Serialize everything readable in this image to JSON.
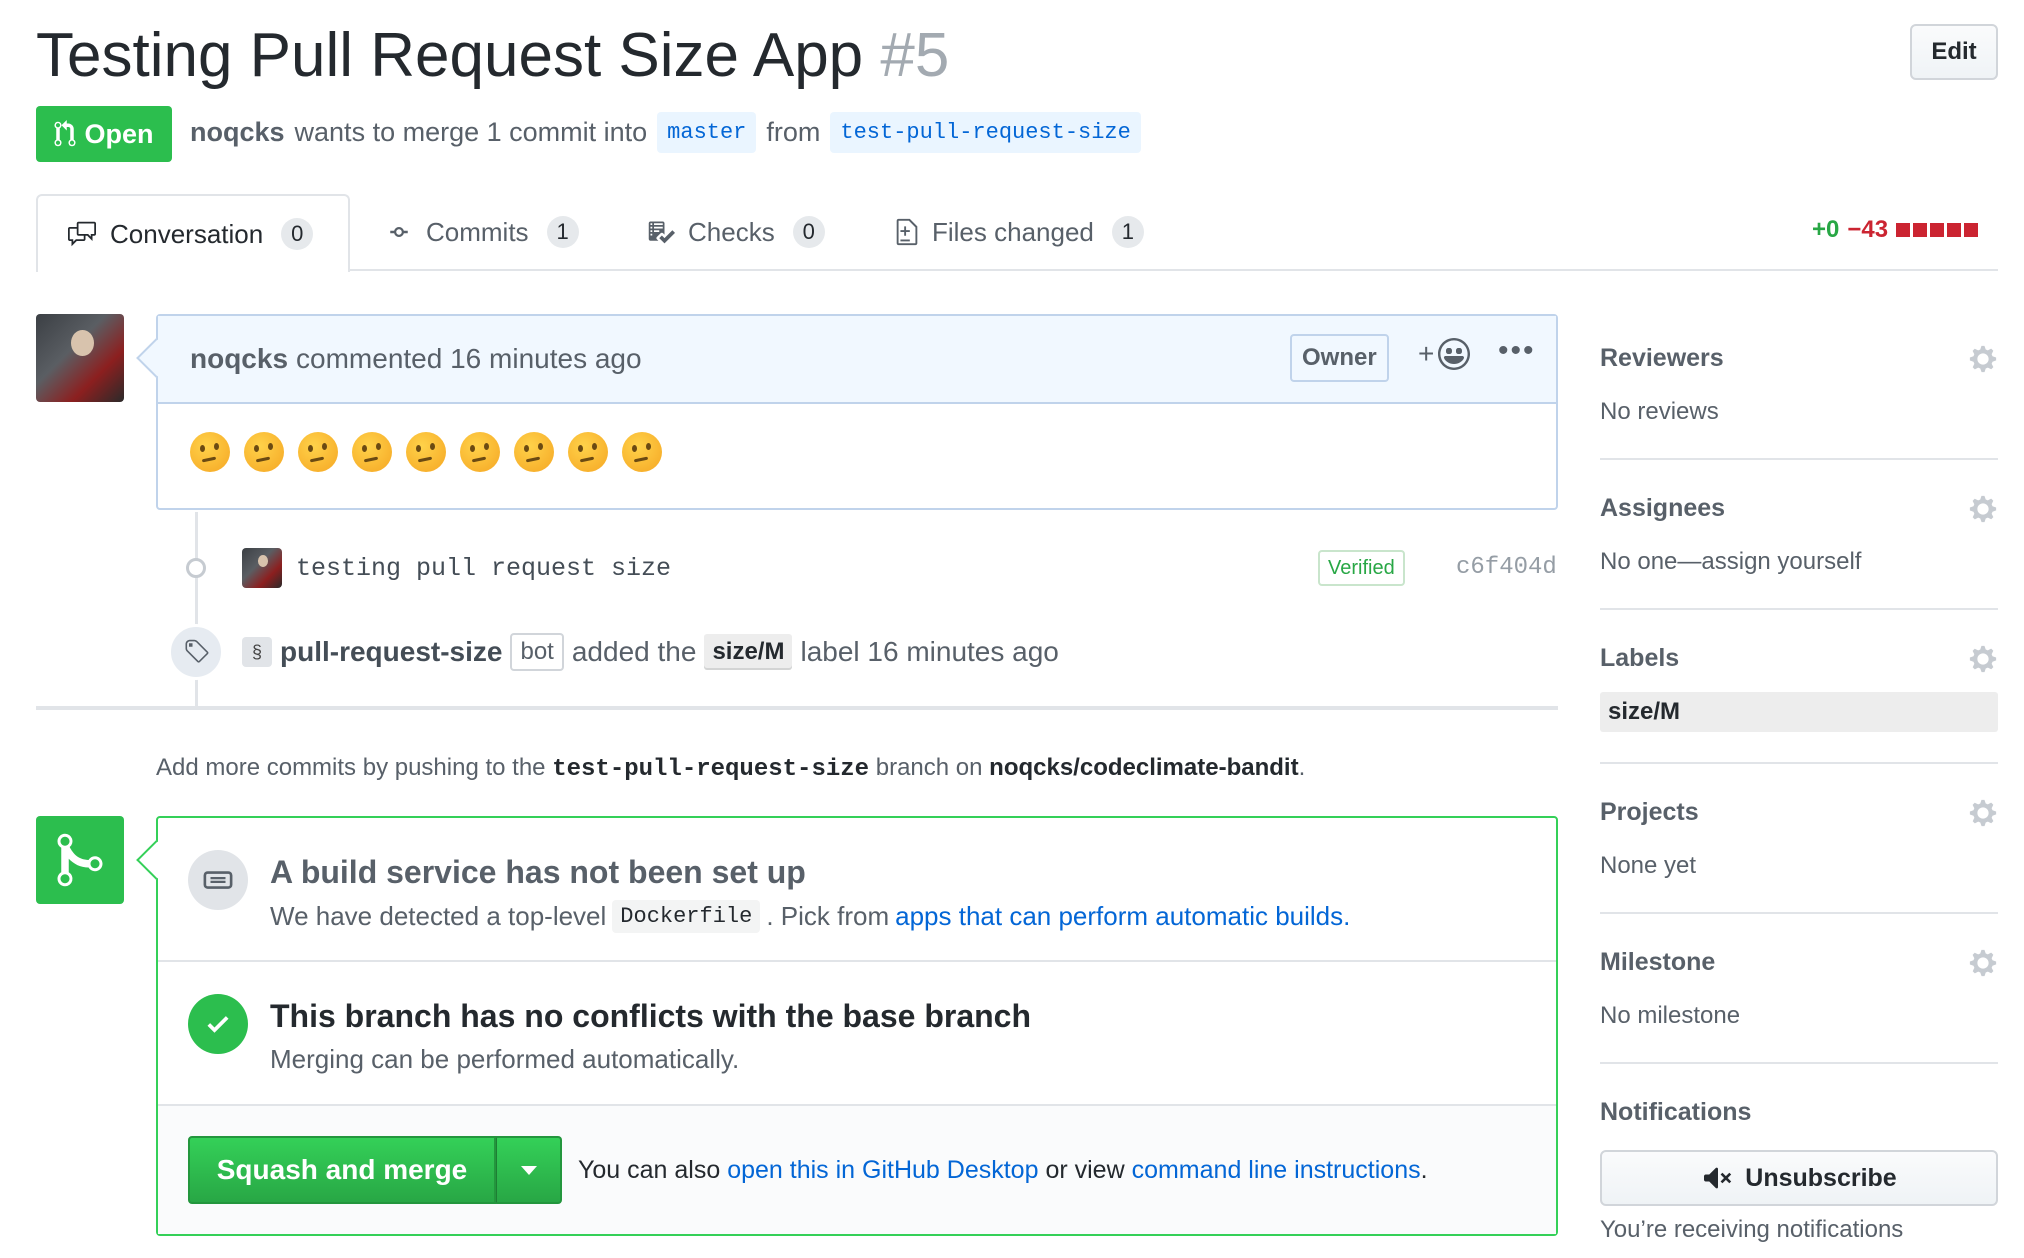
{
  "pr": {
    "title": "Testing Pull Request Size App",
    "number": "#5",
    "edit_label": "Edit",
    "state": "Open",
    "author": "noqcks",
    "merge_text": "wants to merge 1 commit into",
    "base_branch": "master",
    "from_text": "from",
    "head_branch": "test-pull-request-size"
  },
  "tabs": [
    {
      "label": "Conversation",
      "count": "0"
    },
    {
      "label": "Commits",
      "count": "1"
    },
    {
      "label": "Checks",
      "count": "0"
    },
    {
      "label": "Files changed",
      "count": "1"
    }
  ],
  "diffstat": {
    "additions": "+0",
    "deletions": "−43"
  },
  "comment": {
    "author": "noqcks",
    "meta": "commented 16 minutes ago",
    "badge": "Owner",
    "react": "+",
    "more": "•••",
    "emoji_count": 9
  },
  "commit": {
    "message": "testing pull request size",
    "verified": "Verified",
    "sha": "c6f404d"
  },
  "label_event": {
    "actor": "pull-request-size",
    "bot_tag": "bot",
    "text_before": "added the",
    "label": "size/M",
    "text_after": "label 16 minutes ago"
  },
  "push_hint": {
    "prefix": "Add more commits by pushing to the",
    "branch": "test-pull-request-size",
    "middle": "branch on",
    "repo": "noqcks/codeclimate-bandit",
    "suffix": "."
  },
  "merge": {
    "build_title": "A build service has not been set up",
    "build_desc_1": "We have detected a top-level",
    "build_code": "Dockerfile",
    "build_desc_2": ". Pick from",
    "build_link": "apps that can perform automatic builds.",
    "conflict_title": "This branch has no conflicts with the base branch",
    "conflict_desc": "Merging can be performed automatically.",
    "button_label": "Squash and merge",
    "alt_1": "You can also",
    "alt_link_1": "open this in GitHub Desktop",
    "alt_2": "or view",
    "alt_link_2": "command line instructions",
    "alt_3": "."
  },
  "sidebar": {
    "reviewers": {
      "title": "Reviewers",
      "value": "No reviews"
    },
    "assignees": {
      "title": "Assignees",
      "value": "No one—assign yourself"
    },
    "labels": {
      "title": "Labels",
      "value": "size/M"
    },
    "projects": {
      "title": "Projects",
      "value": "None yet"
    },
    "milestone": {
      "title": "Milestone",
      "value": "No milestone"
    },
    "notifications": {
      "title": "Notifications",
      "button": "Unsubscribe",
      "note": "You’re receiving notifications"
    }
  },
  "colors": {
    "accent_green": "#2cbe4e",
    "link_blue": "#0366d6",
    "deletion_red": "#cb2431"
  }
}
